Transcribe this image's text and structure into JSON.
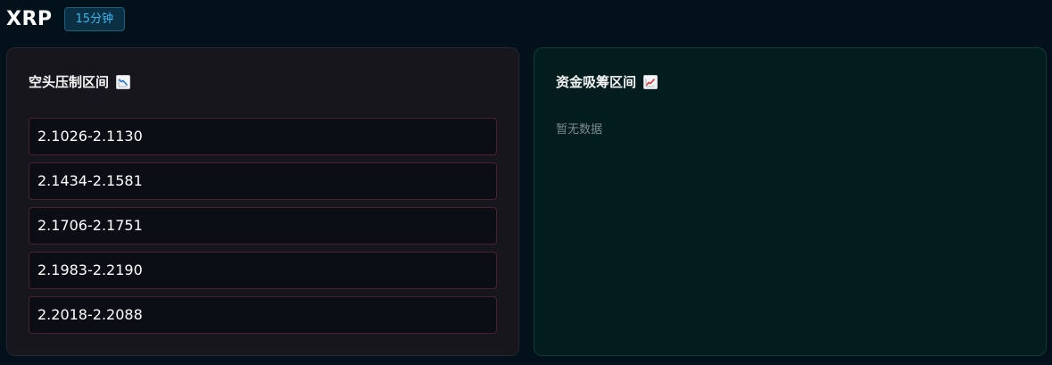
{
  "header": {
    "symbol": "XRP",
    "timeframe": "15分钟"
  },
  "short_panel": {
    "title": "空头压制区间",
    "icon": "chart-decreasing-icon",
    "ranges": [
      "2.1026-2.1130",
      "2.1434-2.1581",
      "2.1706-2.1751",
      "2.1983-2.2190",
      "2.2018-2.2088"
    ]
  },
  "accumulation_panel": {
    "title": "资金吸筹区间",
    "icon": "chart-increasing-icon",
    "empty_text": "暂无数据"
  },
  "colors": {
    "background": "#03121a",
    "short_panel_bg": "#17161c",
    "accum_panel_bg": "#031d1f",
    "range_border": "#4a222b",
    "badge_text": "#39b6ee"
  }
}
